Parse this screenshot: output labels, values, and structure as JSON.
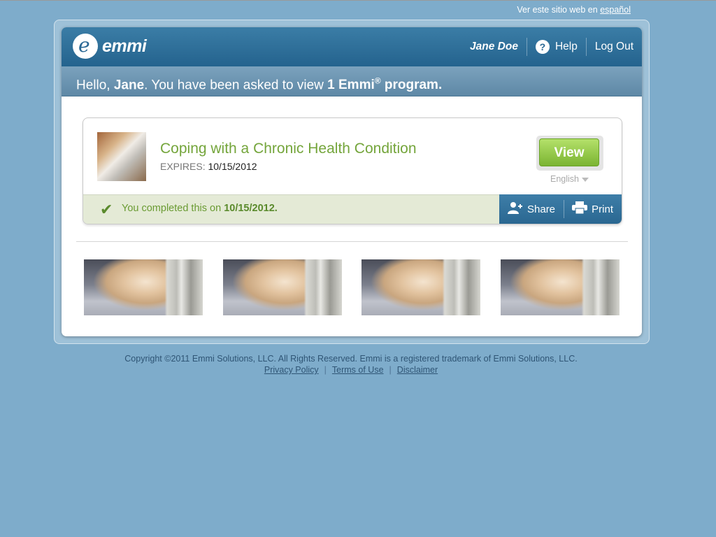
{
  "lang_bar": {
    "prefix": "Ver este sitio web en",
    "link": "español"
  },
  "header": {
    "logo_text": "emmi",
    "user_name": "Jane Doe",
    "help_label": "Help",
    "logout_label": "Log Out"
  },
  "greeting": {
    "hello": "Hello,",
    "name": "Jane",
    "middle": ". You have been asked to view",
    "program": "1 Emmi",
    "reg": "®",
    "end": "program."
  },
  "program_card": {
    "title": "Coping with a Chronic Health Condition",
    "expires_label": "EXPIRES:",
    "expires_date": "10/15/2012",
    "view_label": "View",
    "language": "English",
    "completed_text": "You completed this on",
    "completed_date": "10/15/2012.",
    "share_label": "Share",
    "print_label": "Print"
  },
  "thumbnails": [
    "kitten-photo",
    "kitten-photo",
    "kitten-photo",
    "kitten-photo"
  ],
  "footer": {
    "copyright": "Copyright ©2011 Emmi Solutions, LLC. All Rights Reserved. Emmi is a registered trademark of Emmi Solutions, LLC.",
    "links": [
      "Privacy Policy",
      "Terms of Use",
      "Disclaimer"
    ]
  },
  "colors": {
    "background": "#7eaccb",
    "header": "#2a6894",
    "accent_green": "#74a53b",
    "view_button": "#8cc63f"
  }
}
